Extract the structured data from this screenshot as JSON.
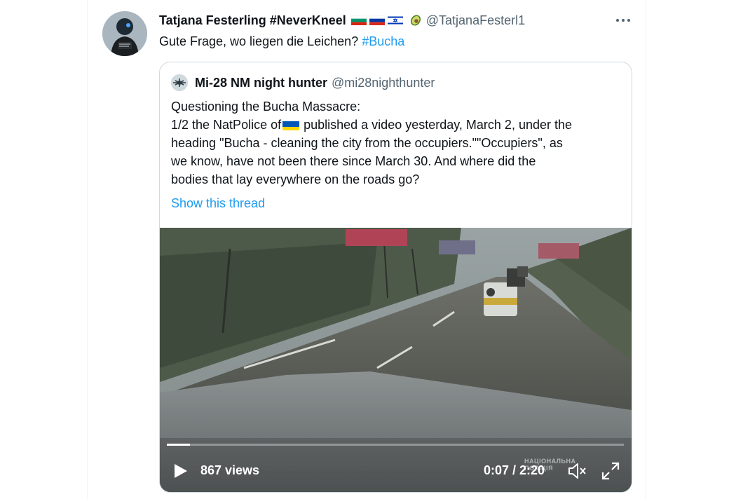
{
  "tweet": {
    "author_name": "Tatjana Festerling #NeverKneel",
    "flags": [
      "bulgaria-flag",
      "russia-flag",
      "israel-flag",
      "avocado-emoji"
    ],
    "handle": "@TatjanaFesterl1",
    "text_before": "Gute Frage, wo liegen die Leichen? ",
    "hashtag": "#Bucha"
  },
  "quoted": {
    "author_name": "Mi-28 NM night hunter",
    "handle": "@mi28nighthunter",
    "lines": {
      "l1": "Questioning the Bucha Massacre:",
      "l2_a": "1/2 the NatPolice of",
      "l2_b": "published a video yesterday, March 2, under the",
      "l3": "heading \"Bucha - cleaning the city from the occupiers.\"\"Occupiers\", as",
      "l4": "we know, have not been there since March 30. And where did the",
      "l5": "bodies that lay everywhere on the roads go?"
    },
    "show_thread": "Show this thread"
  },
  "video": {
    "views": "867 views",
    "time": "0:07 / 2:20",
    "progress_fraction": 0.05,
    "watermark_line1": "НАЦІОНАЛЬНА",
    "watermark_line2": "ПОЛІЦІЯ"
  },
  "colors": {
    "accent": "#1d9bf0",
    "text": "#0f1419",
    "secondary": "#536471"
  }
}
